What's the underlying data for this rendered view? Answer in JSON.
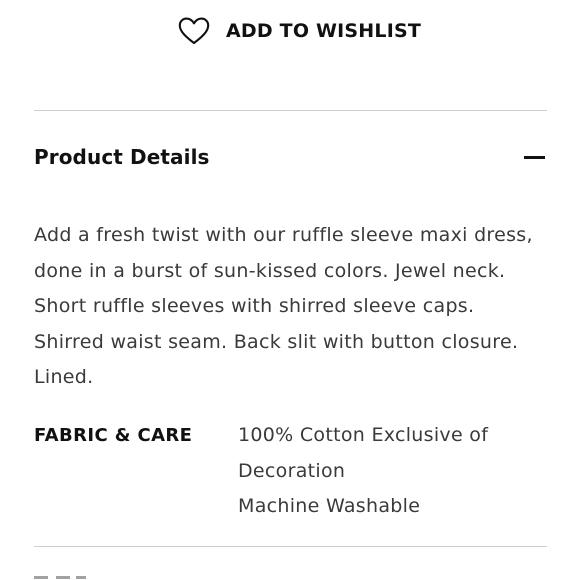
{
  "wishlist": {
    "label": "ADD TO WISHLIST",
    "icon": "heart-outline-icon"
  },
  "product_details": {
    "title": "Product Details",
    "toggle_icon": "minus-icon",
    "expanded": true,
    "description_lines": [
      "Add a fresh twist with our ruffle sleeve maxi dress,",
      "done in a burst of sun-kissed colors. Jewel neck.",
      "Short ruffle sleeves with shirred sleeve caps.",
      "Shirred waist seam. Back slit with button closure.",
      "Lined."
    ],
    "fabric_care": {
      "label": "FABRIC & CARE",
      "value_lines": [
        "100% Cotton Exclusive of",
        "Decoration",
        "Machine Washable"
      ]
    }
  },
  "colors": {
    "text_primary": "#111111",
    "text_body": "#3a3a3a",
    "divider": "#cfcfcf",
    "background": "#ffffff"
  }
}
